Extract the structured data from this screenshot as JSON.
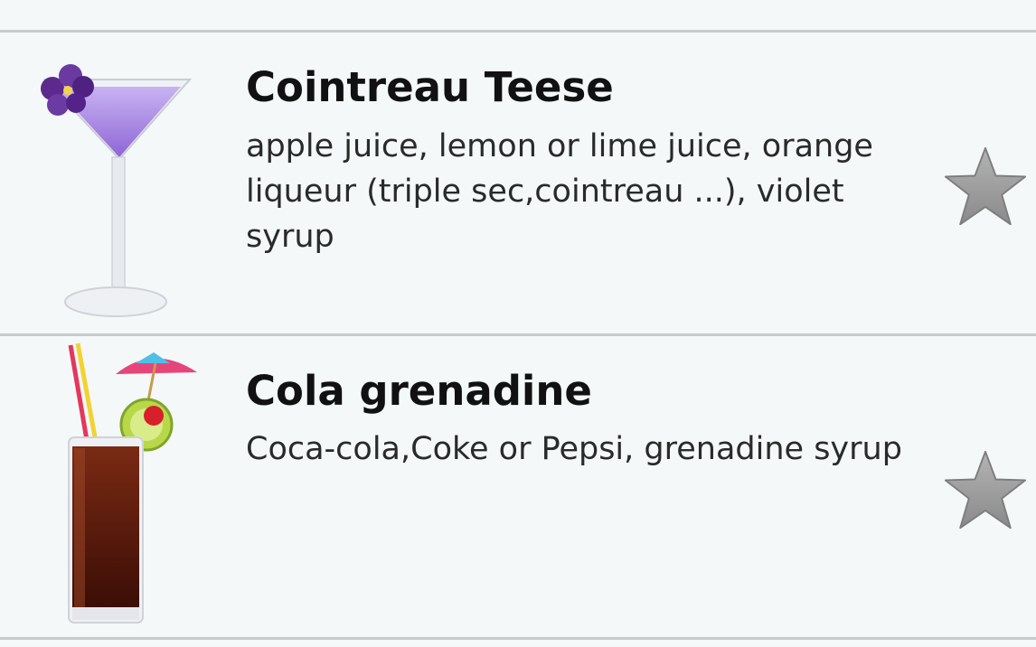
{
  "drinks": [
    {
      "name": "Cointreau Teese",
      "ingredients": "apple juice, lemon or lime juice, orange liqueur (triple sec,cointreau ...), violet syrup",
      "image_icon": "violet-martini-icon",
      "favorite_icon": "star-icon",
      "favorite": false
    },
    {
      "name": "Cola grenadine",
      "ingredients": "Coca-cola,Coke or Pepsi, grenadine syrup",
      "image_icon": "cola-highball-icon",
      "favorite_icon": "star-icon",
      "favorite": false
    }
  ],
  "colors": {
    "background": "#f4f8f8",
    "divider": "#c8cbcb",
    "star_fill": "#9a9a9a",
    "martini_liquid": "#a98be6",
    "cola_liquid": "#4a1408"
  }
}
